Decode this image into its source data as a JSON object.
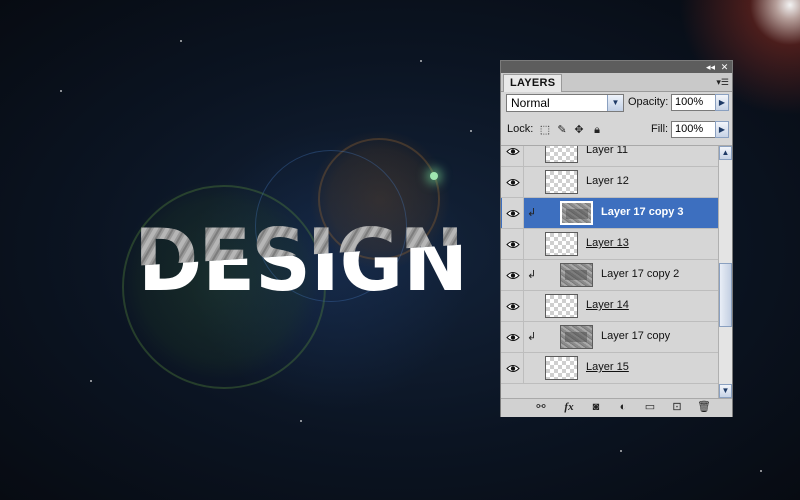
{
  "panel": {
    "tab_label": "LAYERS",
    "blend_mode": "Normal",
    "opacity_label": "Opacity:",
    "opacity_value": "100%",
    "lock_label": "Lock:",
    "fill_label": "Fill:",
    "fill_value": "100%",
    "title_buttons": [
      "◂◂",
      "✕"
    ],
    "lock_icons": [
      "lock-transparent-icon",
      "lock-image-icon",
      "lock-position-icon",
      "lock-all-icon"
    ],
    "bottom_icons": [
      "link-layers-icon",
      "fx-icon",
      "add-mask-icon",
      "adjustment-layer-icon",
      "new-group-icon",
      "new-layer-icon",
      "delete-layer-icon"
    ]
  },
  "layers": [
    {
      "name": "Layer 11",
      "thumb": "transparent",
      "clipped": false,
      "selected": false,
      "underlined": false
    },
    {
      "name": "Layer 12",
      "thumb": "transparent",
      "clipped": false,
      "selected": false,
      "underlined": false
    },
    {
      "name": "Layer 17 copy 3",
      "thumb": "texture",
      "clipped": true,
      "selected": true,
      "underlined": false
    },
    {
      "name": "Layer 13",
      "thumb": "transparent",
      "clipped": false,
      "selected": false,
      "underlined": true
    },
    {
      "name": "Layer 17 copy 2",
      "thumb": "texture",
      "clipped": true,
      "selected": false,
      "underlined": false
    },
    {
      "name": "Layer 14",
      "thumb": "transparent",
      "clipped": false,
      "selected": false,
      "underlined": true
    },
    {
      "name": "Layer 17 copy",
      "thumb": "texture",
      "clipped": true,
      "selected": false,
      "underlined": false
    },
    {
      "name": "Layer 15",
      "thumb": "transparent",
      "clipped": false,
      "selected": false,
      "underlined": true
    }
  ],
  "canvas": {
    "text": "DESIGN"
  },
  "colors": {
    "selection": "#3d6fbf",
    "panel_bg": "#d6d6d6"
  }
}
